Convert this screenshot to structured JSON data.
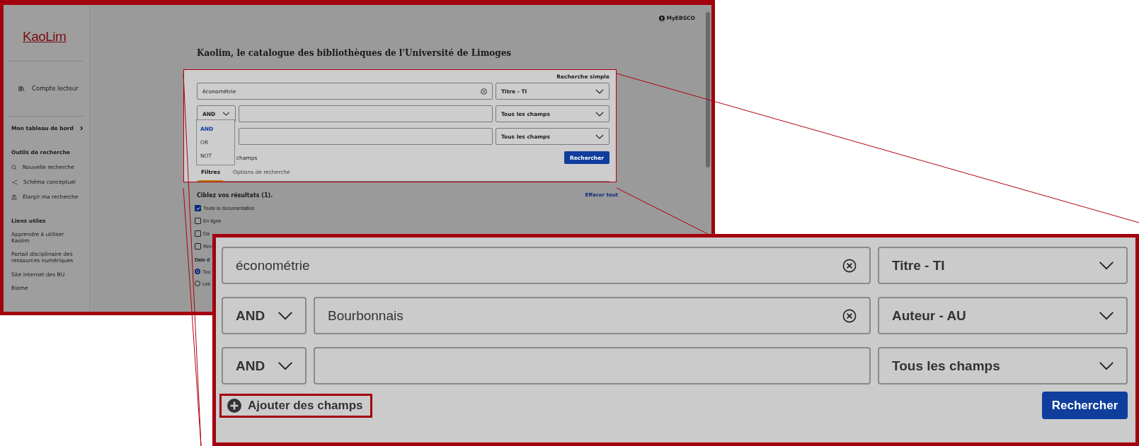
{
  "sidebar": {
    "logo": "KaoLim",
    "account": "Compte lecteur",
    "dashboard": "Mon tableau de bord",
    "sections": [
      {
        "heading": "Outils de recherche",
        "items": [
          "Nouvelle recherche",
          "Schéma conceptuel",
          "Elargir ma recherche"
        ]
      },
      {
        "heading": "Liens utiles",
        "items": [
          "Apprendre à utiliser Kaolim",
          "Portail disciplinaire des ressources numériques",
          "Site internet des BU",
          "Biome"
        ]
      }
    ]
  },
  "header": {
    "account_link": "MyEBSCO"
  },
  "title": "Kaolim, le catalogue des bibliothèques de l'Université de Limoges",
  "search": {
    "mode_link": "Recherche simple",
    "rows": [
      {
        "value": "économétrie",
        "field": "Titre - TI"
      },
      {
        "operator": "AND",
        "value": "",
        "field": "Tous les champs"
      },
      {
        "value": "",
        "field": "Tous les champs"
      }
    ],
    "operator_menu": [
      {
        "label": "AND",
        "selected": true
      },
      {
        "label": "OR",
        "selected": false
      },
      {
        "label": "NOT",
        "selected": false
      }
    ],
    "add_fields": "champs",
    "button": "Rechercher",
    "tabs": [
      {
        "label": "Filtres",
        "selected": true
      },
      {
        "label": "Options de recherche",
        "selected": false
      }
    ]
  },
  "filters": {
    "heading": "Ciblez vos résultats (1).",
    "clear": "Effacer tout",
    "checkboxes": [
      {
        "label": "Toute la documentation",
        "checked": true
      },
      {
        "label": "En ligne",
        "checked": false
      },
      {
        "label": "Da",
        "checked": false
      },
      {
        "label": "Rev",
        "checked": false
      }
    ],
    "date_heading": "Date d",
    "radios": [
      {
        "label": "Tou",
        "selected": true
      },
      {
        "label": "Les",
        "selected": false
      }
    ]
  },
  "zoom_inset": {
    "rows": [
      {
        "value": "économétrie",
        "field": "Titre - TI"
      },
      {
        "operator": "AND",
        "value": "Bourbonnais",
        "field": "Auteur - AU"
      },
      {
        "operator": "AND",
        "value": "",
        "field": "Tous les champs"
      }
    ],
    "add_fields": "Ajouter des champs",
    "button": "Rechercher"
  }
}
